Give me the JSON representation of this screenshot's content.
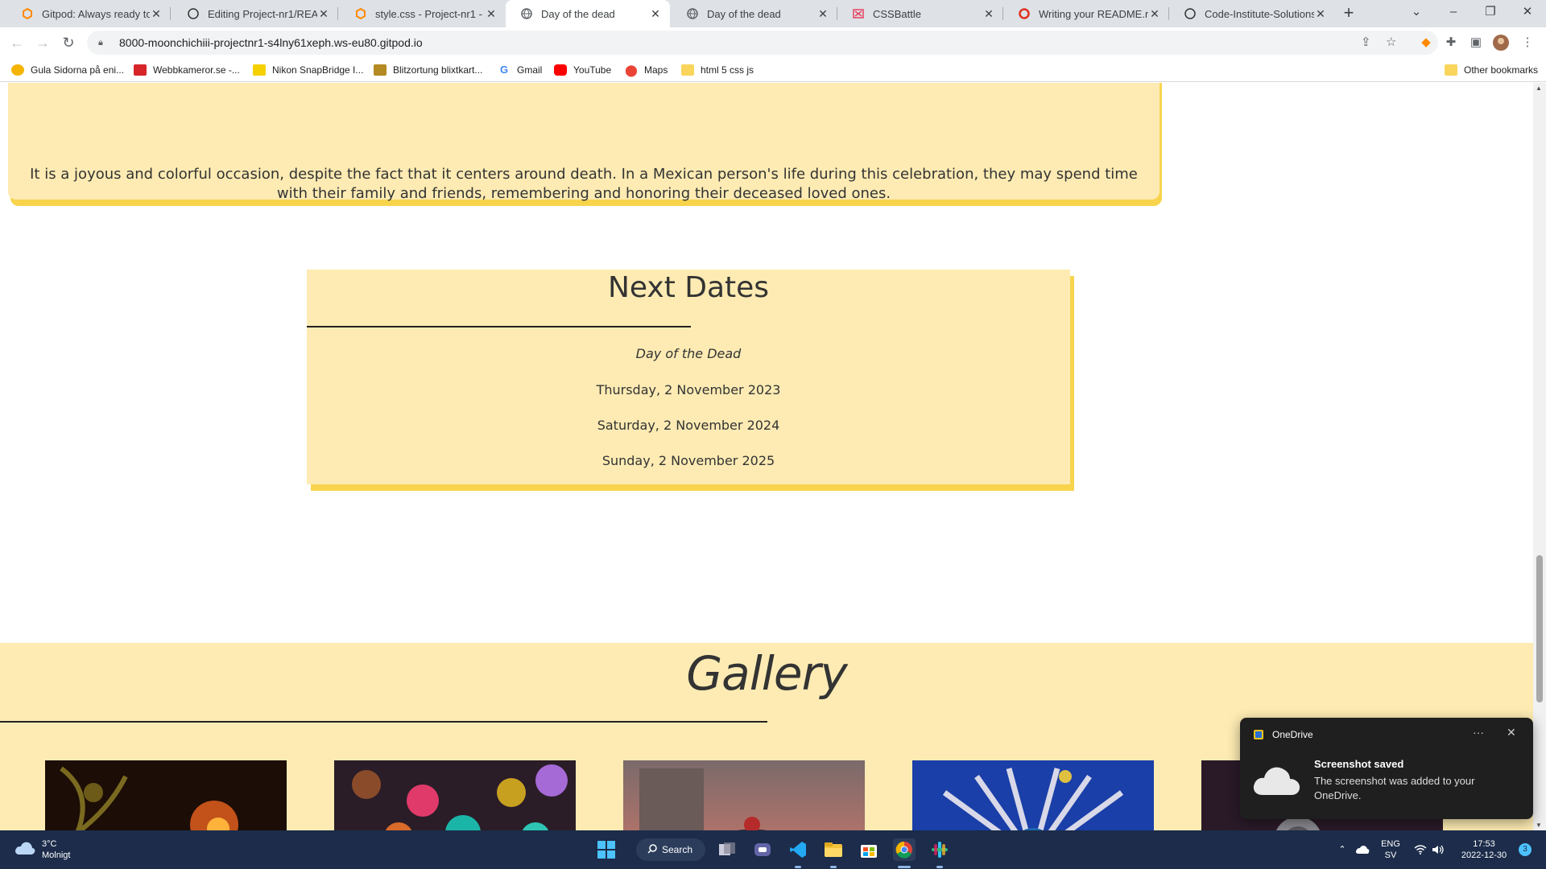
{
  "browser": {
    "tabs": [
      {
        "title": "Gitpod: Always ready to co",
        "icon": "gitpod-icon",
        "active": false
      },
      {
        "title": "Editing Project-nr1/READM",
        "icon": "github-icon",
        "active": false
      },
      {
        "title": "style.css - Project-nr1 - Git",
        "icon": "gitpod-icon",
        "active": false
      },
      {
        "title": "Day of the dead",
        "icon": "globe-icon",
        "active": true
      },
      {
        "title": "Day of the dead",
        "icon": "globe-icon",
        "active": false
      },
      {
        "title": "CSSBattle",
        "icon": "cssbattle-icon",
        "active": false
      },
      {
        "title": "Writing your README.md",
        "icon": "opera-icon",
        "active": false
      },
      {
        "title": "Code-Institute-Solutions/r",
        "icon": "github-icon",
        "active": false
      }
    ],
    "url": "8000-moonchichiii-projectnr1-s4lny61xeph.ws-eu80.gitpod.io",
    "bookmarks": [
      {
        "label": "Gula Sidorna på eni..."
      },
      {
        "label": "Webbkameror.se -..."
      },
      {
        "label": "Nikon SnapBridge I..."
      },
      {
        "label": "Blitzortung blixtkart..."
      },
      {
        "label": "Gmail"
      },
      {
        "label": "YouTube"
      },
      {
        "label": "Maps"
      },
      {
        "label": "html 5 css js"
      }
    ],
    "other_bookmarks": "Other bookmarks"
  },
  "page": {
    "intro_text": "It is a joyous and colorful occasion, despite the fact that it centers around death. In a Mexican person's life during this celebration, they may spend time with their family and friends, remembering and honoring their deceased loved ones.",
    "next_dates": {
      "heading": "Next Dates",
      "event": "Day of the Dead",
      "dates": [
        "Thursday, 2 November 2023",
        "Saturday, 2 November 2024",
        "Sunday, 2 November 2025"
      ]
    },
    "gallery": {
      "heading": "Gallery"
    }
  },
  "notification": {
    "app": "OneDrive",
    "title": "Screenshot saved",
    "body": "The screenshot was added to your OneDrive."
  },
  "taskbar": {
    "temperature": "3°C",
    "condition": "Molnigt",
    "search_label": "Search",
    "lang_top": "ENG",
    "lang_bottom": "SV",
    "time": "17:53",
    "date": "2022-12-30",
    "notification_count": "3"
  },
  "colors": {
    "card_bg": "#fdebb3",
    "card_shadow": "#f8d44c",
    "taskbar_bg": "#1c2c4a"
  }
}
